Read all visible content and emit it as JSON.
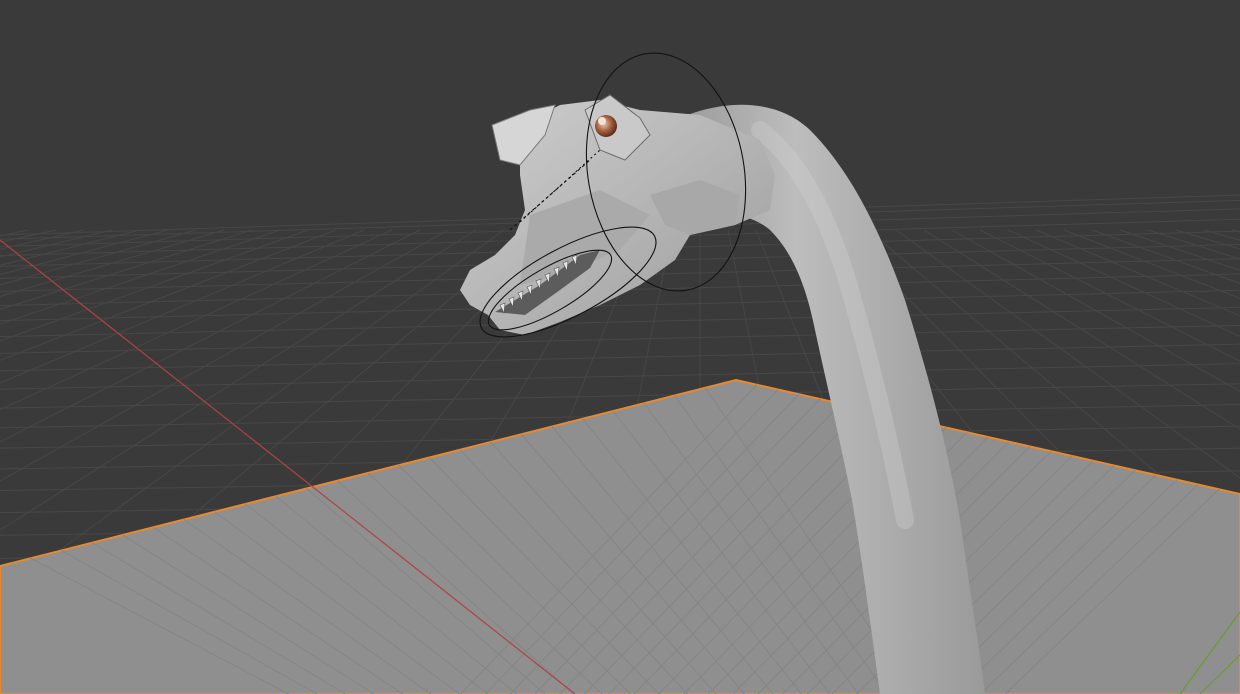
{
  "viewport": {
    "mode": "3D Viewport",
    "shading": "solid",
    "colors": {
      "background": "#3a3a3a",
      "grid_line": "#474747",
      "plane_fill": "#8f8f8f",
      "plane_selected_outline": "#e8892d",
      "x_axis": "#b0414a",
      "y_axis": "#6c9a2b",
      "model": "#b8b8b8",
      "bone_outline": "#121212",
      "eye": "#a05a3a"
    }
  },
  "scene_objects": [
    {
      "name": "plane",
      "state": "selected"
    },
    {
      "name": "dinosaur-head-neck-mesh",
      "state": "unselected"
    },
    {
      "name": "armature-bone-envelopes",
      "state": "visible"
    }
  ]
}
